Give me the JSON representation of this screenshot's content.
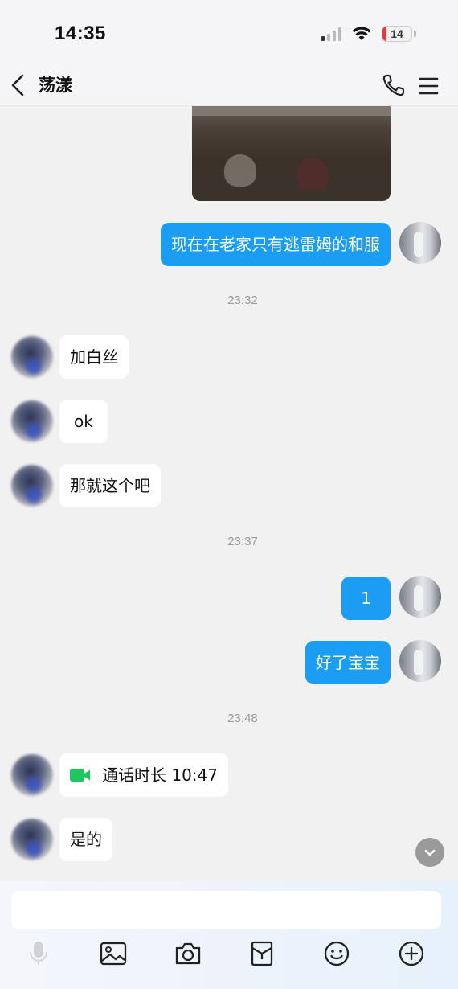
{
  "status_bar": {
    "time": "14:35",
    "battery": "14",
    "battery_level": 0.14
  },
  "header": {
    "title": "荡漾"
  },
  "messages": [
    {
      "side": "out",
      "type": "image"
    },
    {
      "side": "out",
      "text": "现在在老家只有逃雷姆的和服"
    },
    {
      "type": "timestamp",
      "text": "23:32"
    },
    {
      "side": "in",
      "text": "加白丝"
    },
    {
      "side": "in",
      "text": "ok"
    },
    {
      "side": "in",
      "text": "那就这个吧"
    },
    {
      "type": "timestamp",
      "text": "23:37"
    },
    {
      "side": "out",
      "text": "1"
    },
    {
      "side": "out",
      "text": "好了宝宝"
    },
    {
      "type": "timestamp",
      "text": "23:48"
    },
    {
      "side": "in",
      "type": "call",
      "text": "通话时长 10:47"
    },
    {
      "side": "in",
      "text": "是的"
    }
  ],
  "input": {
    "placeholder": ""
  },
  "toolbar": {
    "icons": [
      "voice-icon",
      "image-icon",
      "camera-icon",
      "red-packet-icon",
      "emoji-icon",
      "plus-icon"
    ]
  },
  "colors": {
    "outgoing_bubble": "#1a9df2",
    "incoming_bubble": "#ffffff",
    "call_icon": "#1ec760",
    "background": "#f1f1f1"
  }
}
